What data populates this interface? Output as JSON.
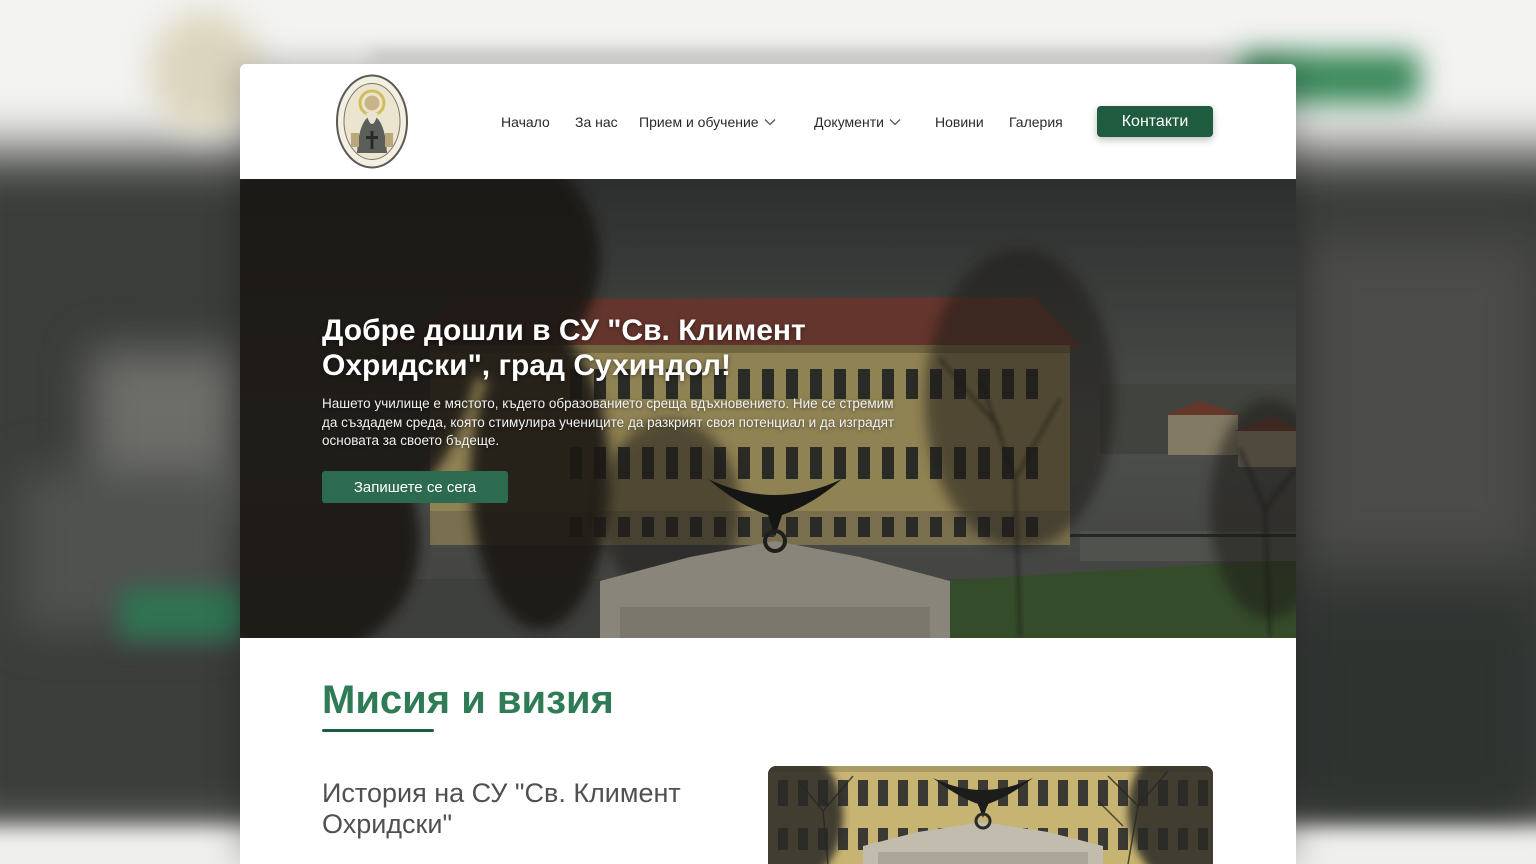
{
  "header": {
    "nav": [
      {
        "label": "Начало"
      },
      {
        "label": "За нас"
      },
      {
        "label": "Прием и обучение",
        "icon": "chevron-down-icon"
      },
      {
        "label": "Документи",
        "icon": "chevron-down-icon"
      },
      {
        "label": "Новини"
      },
      {
        "label": "Галерия"
      }
    ],
    "contact_button": "Контакти",
    "logo_icon": "school-emblem"
  },
  "hero": {
    "title": "Добре дошли в СУ \"Св. Климент Охридски\", град Сухиндол!",
    "text": "Нашето училище е мястото, където образованието среща вдъхновението. Ние се стремим да създадем среда, която стимулира учениците да разкрият своя потенциал и да изградят основата за своето бъдеще.",
    "cta": "Запишете се сега"
  },
  "mission": {
    "heading": "Мисия и визия",
    "history_title": "История на СУ \"Св. Климент Охридски\""
  },
  "colors": {
    "primary_dark": "#1f5b3e",
    "heading_green": "#2e7b55",
    "cta_green": "#2c6b4f",
    "text_gray": "#505050"
  }
}
